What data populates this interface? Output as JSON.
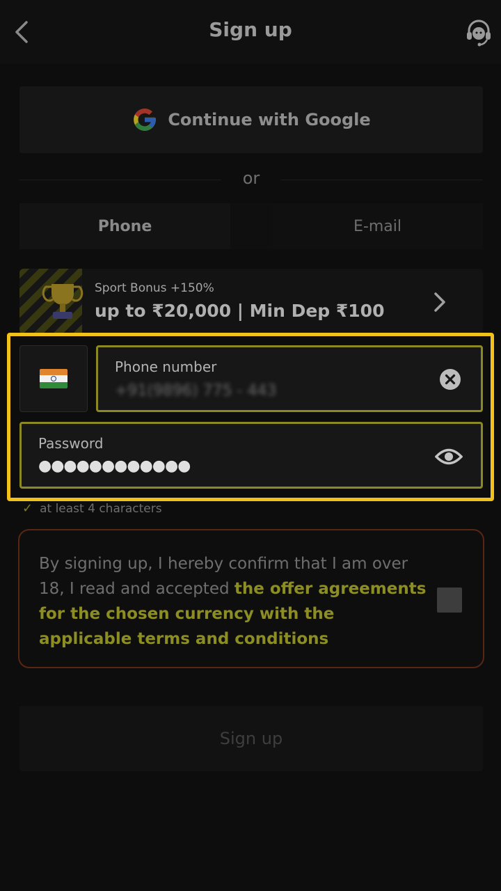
{
  "header": {
    "title": "Sign up"
  },
  "google": {
    "label": "Continue with Google"
  },
  "divider": {
    "text": "or"
  },
  "tabs": [
    {
      "label": "Phone",
      "active": true
    },
    {
      "label": "E-mail",
      "active": false
    }
  ],
  "promo": {
    "small": "Sport Bonus +150%",
    "big": "up to ₹20,000 | Min Dep ₹100"
  },
  "phone_field": {
    "label": "Phone number",
    "value": "+91(9896) 775 - 443"
  },
  "password_field": {
    "label": "Password",
    "value": "●●●●●●●●●●●●"
  },
  "hint": {
    "text": "at least 4 characters"
  },
  "consent": {
    "text": "By signing up, I hereby confirm that I am over 18, I read and accepted ",
    "link": "the offer agreements for the chosen currency with the applicable terms and conditions"
  },
  "signup_button": {
    "label": "Sign up"
  },
  "colors": {
    "highlight": "#f2c21a",
    "field_border": "#8b8a22",
    "link": "#8c8d22",
    "consent_border": "#5a2614"
  },
  "icons": [
    "back-arrow-icon",
    "headset-icon",
    "google-icon",
    "trophy-icon",
    "chevron-right-icon",
    "india-flag-icon",
    "clear-circle-icon",
    "eye-icon",
    "check-icon"
  ]
}
